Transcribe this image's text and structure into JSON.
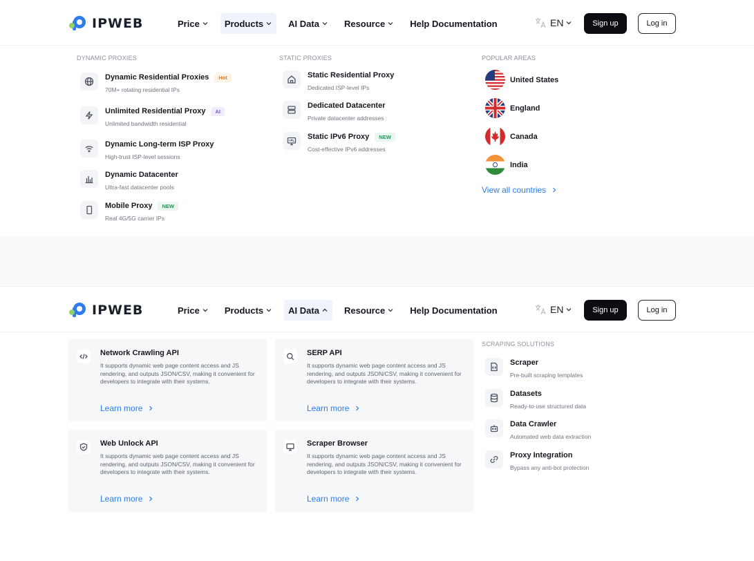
{
  "logo": {
    "text": "IPWEB"
  },
  "nav": {
    "items": [
      {
        "label": "Price"
      },
      {
        "label": "Products"
      },
      {
        "label": "AI Data"
      },
      {
        "label": "Resource"
      },
      {
        "label": "Help Documentation"
      }
    ],
    "lang": "EN",
    "signup": "Sign up",
    "login": "Log in"
  },
  "products_menu": {
    "dynamic_heading": "DYNAMIC PROXIES",
    "dynamic": [
      {
        "title": "Dynamic Residential Proxies",
        "badge": "Hot",
        "desc": "70M+ rotating residential IPs",
        "icon": "globe-icon"
      },
      {
        "title": "Unlimited Residential Proxy",
        "badge": "AI",
        "desc": "Unlimited bandwidth residential",
        "icon": "lightning-icon"
      },
      {
        "title": "Dynamic Long-term ISP Proxy",
        "badge": "",
        "desc": "High-trust ISP-level sessions",
        "icon": "wifi-icon"
      },
      {
        "title": "Dynamic Datacenter",
        "badge": "",
        "desc": "Ultra-fast datacenter pools",
        "icon": "bar-chart-icon"
      },
      {
        "title": "Mobile Proxy",
        "badge": "NEW",
        "desc": "Real 4G/5G carrier IPs",
        "icon": "mobile-icon"
      }
    ],
    "static_heading": "STATIC PROXIES",
    "static": [
      {
        "title": "Static Residential Proxy",
        "badge": "",
        "desc": "Dedicated ISP-level IPs",
        "icon": "home-icon"
      },
      {
        "title": "Dedicated Datacenter",
        "badge": "",
        "desc": "Private datacenter addresses",
        "icon": "server-icon"
      },
      {
        "title": "Static IPv6 Proxy",
        "badge": "NEW",
        "desc": "Cost-effective IPv6 addresses",
        "icon": "ipv6-icon"
      }
    ],
    "popular_heading": "POPULAR AREAS",
    "countries": [
      {
        "name": "United States",
        "icon": "us-flag-icon"
      },
      {
        "name": "England",
        "icon": "uk-flag-icon"
      },
      {
        "name": "Canada",
        "icon": "canada-flag-icon"
      },
      {
        "name": "India",
        "icon": "india-flag-icon"
      }
    ],
    "view_all": "View all countries"
  },
  "ai_menu": {
    "cards": [
      {
        "title": "Network Crawling API",
        "desc": "It supports dynamic web page content access and JS rendering, and outputs JSON/CSV, making it convenient for developers to integrate with their systems.",
        "link": "Learn more",
        "icon": "code-icon"
      },
      {
        "title": "SERP API",
        "desc": "It supports dynamic web page content access and JS rendering, and outputs JSON/CSV, making it convenient for developers to integrate with their systems.",
        "link": "Learn more",
        "icon": "search-icon"
      },
      {
        "title": "Web Unlock API",
        "desc": "It supports dynamic web page content access and JS rendering, and outputs JSON/CSV, making it convenient for developers to integrate with their systems.",
        "link": "Learn more",
        "icon": "shield-icon"
      },
      {
        "title": "Scraper Browser",
        "desc": "It supports dynamic web page content access and JS rendering, and outputs JSON/CSV, making it convenient for developers to integrate with their systems.",
        "link": "Learn more",
        "icon": "monitor-icon"
      }
    ],
    "solutions_heading": "SCRAPING SOLUTIONS",
    "solutions": [
      {
        "title": "Scraper",
        "desc": "Pre-built scraping templates",
        "icon": "file-code-icon"
      },
      {
        "title": "Datasets",
        "desc": "Ready-to-use structured data",
        "icon": "database-icon"
      },
      {
        "title": "Data Crawler",
        "desc": "Automated web data extraction",
        "icon": "robot-icon"
      },
      {
        "title": "Proxy Integration",
        "desc": "Bypass any anti-bot protection",
        "icon": "link-icon"
      }
    ]
  },
  "colors": {
    "accent": "#2b7de9",
    "dark_button": "#0b0d12",
    "hot": "#f07a1a",
    "ai": "#8652e8",
    "new": "#1e9a55"
  }
}
